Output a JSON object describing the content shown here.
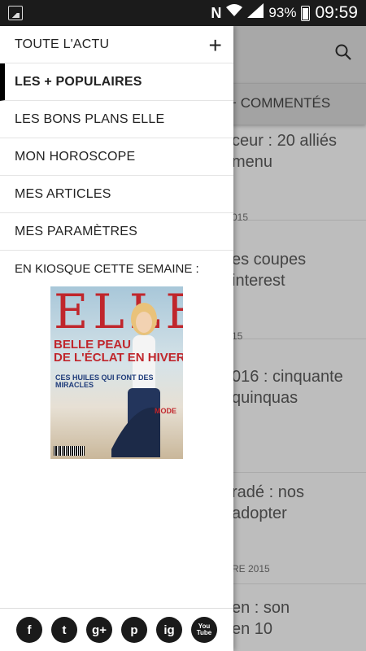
{
  "statusbar": {
    "battery": "93%",
    "time": "09:59",
    "n_icon": "N"
  },
  "drawer": {
    "items": [
      {
        "label": "TOUTE L'ACTU"
      },
      {
        "label": "LES + POPULAIRES"
      },
      {
        "label": "LES BONS PLANS ELLE"
      },
      {
        "label": "MON HOROSCOPE"
      },
      {
        "label": "MES ARTICLES"
      },
      {
        "label": "MES PARAMÈTRES"
      }
    ],
    "kiosk_label": "EN KIOSQUE CETTE SEMAINE :",
    "cover": {
      "logo": "ELLE",
      "line1": "BELLE PEAU",
      "line2": "DE L'ÉCLAT EN HIVER",
      "line3": "CES HUILES QUI FONT DES MIRACLES",
      "mode": "MODE"
    },
    "social": [
      "f",
      "t",
      "g+",
      "p",
      "ig",
      "You",
      "Tube"
    ]
  },
  "background": {
    "tab_label": "S + COMMENTÉS",
    "articles": [
      {
        "title_line1": "ceur : 20 alliés",
        "title_line2": "menu",
        "date": ""
      },
      {
        "title_line1": "es coupes",
        "title_line2": "interest",
        "date": "015"
      },
      {
        "title_line1": "016 : cinquante",
        "title_line2": "quinquas",
        "date": "15"
      },
      {
        "title_line1": "radé : nos",
        "title_line2": "adopter",
        "date": ""
      },
      {
        "title_line1": "en : son",
        "title_line2": "en 10",
        "date": "RE 2015"
      }
    ]
  }
}
